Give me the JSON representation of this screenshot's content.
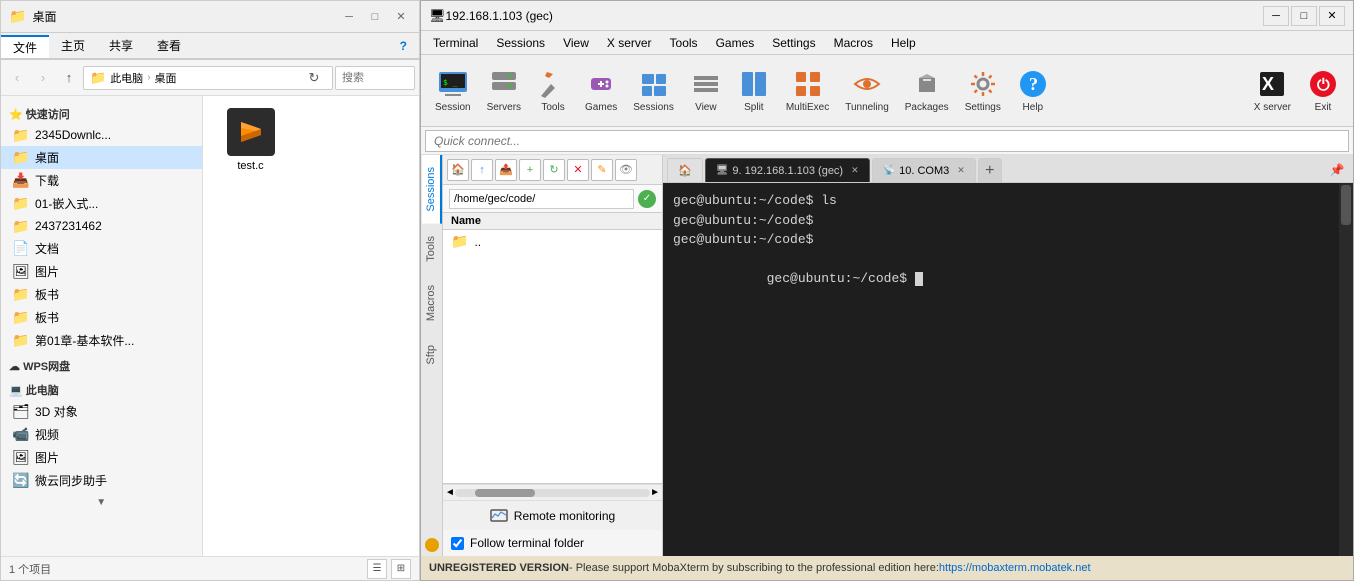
{
  "file_explorer": {
    "title": "桌面",
    "title_icon": "folder",
    "ribbon_tabs": [
      "文件",
      "主页",
      "共享",
      "查看"
    ],
    "active_tab": "主页",
    "address_bar": {
      "parts": [
        "此电脑",
        "桌面"
      ],
      "separator": "›"
    },
    "search_placeholder": "搜索",
    "nav_buttons": {
      "back": "‹",
      "forward": "›",
      "up": "↑",
      "history": "▾",
      "refresh": "↻"
    },
    "sidebar_sections": {
      "quick_access": {
        "label": "快速访问",
        "items": [
          {
            "label": "2345Downlc...",
            "icon": "folder",
            "pinned": true
          },
          {
            "label": "桌面",
            "icon": "folder",
            "active": true,
            "pinned": true
          },
          {
            "label": "下载",
            "icon": "folder-down",
            "pinned": true
          },
          {
            "label": "01-嵌入式...",
            "icon": "folder-yellow",
            "pinned": true
          },
          {
            "label": "2437231462",
            "icon": "folder-yellow",
            "pinned": true
          },
          {
            "label": "文档",
            "icon": "folder-doc",
            "pinned": true
          },
          {
            "label": "图片",
            "icon": "folder-pic",
            "pinned": true
          },
          {
            "label": "板书",
            "icon": "folder-yellow",
            "pinned": true
          },
          {
            "label": "板书",
            "icon": "folder-yellow",
            "pinned": true
          },
          {
            "label": "第01章-基本软件...",
            "icon": "folder-yellow",
            "pinned": true
          }
        ]
      },
      "wps": {
        "label": "WPS网盘",
        "icon": "cloud"
      },
      "this_pc": {
        "label": "此电脑",
        "items": [
          {
            "label": "3D 对象",
            "icon": "3d"
          },
          {
            "label": "视频",
            "icon": "video"
          },
          {
            "label": "图片",
            "icon": "picture"
          },
          {
            "label": "微云同步助手",
            "icon": "cloud-sync"
          }
        ]
      }
    },
    "files": [
      {
        "name": "test.c",
        "type": "sublime"
      }
    ],
    "statusbar": {
      "count_label": "1 个项目",
      "view_icons": [
        "list",
        "detail"
      ]
    }
  },
  "mobaxterm": {
    "title": "192.168.1.103 (gec)",
    "title_icon": "terminal",
    "menu_items": [
      "Terminal",
      "Sessions",
      "View",
      "X server",
      "Tools",
      "Games",
      "Settings",
      "Macros",
      "Help"
    ],
    "toolbar_items": [
      {
        "label": "Session",
        "icon": "session"
      },
      {
        "label": "Servers",
        "icon": "servers"
      },
      {
        "label": "Tools",
        "icon": "tools"
      },
      {
        "label": "Games",
        "icon": "games"
      },
      {
        "label": "Sessions",
        "icon": "sessions"
      },
      {
        "label": "View",
        "icon": "view"
      },
      {
        "label": "Split",
        "icon": "split"
      },
      {
        "label": "MultiExec",
        "icon": "multiexec"
      },
      {
        "label": "Tunneling",
        "icon": "tunneling"
      },
      {
        "label": "Packages",
        "icon": "packages"
      },
      {
        "label": "Settings",
        "icon": "settings"
      },
      {
        "label": "Help",
        "icon": "help"
      },
      {
        "label": "X server",
        "icon": "xserver"
      },
      {
        "label": "Exit",
        "icon": "exit"
      }
    ],
    "quick_connect_placeholder": "Quick connect...",
    "sidebar_tabs": [
      "Sessions",
      "Tools",
      "Macros",
      "Sftp"
    ],
    "sftp_panel": {
      "toolbar_buttons": [
        "home",
        "upload",
        "upload-folder",
        "new-folder",
        "refresh",
        "delete",
        "rename",
        "hidden"
      ],
      "path": "/home/gec/code/",
      "path_ok": "✓",
      "header": "Name",
      "items": [
        {
          "name": "..",
          "icon": "folder-up"
        }
      ],
      "scroll_buttons": [
        "◄",
        "►"
      ],
      "monitor_btn": "Remote monitoring",
      "follow_terminal_label": "Follow terminal folder",
      "follow_terminal_checked": true
    },
    "terminal": {
      "tabs": [
        {
          "label": "9. 192.168.1.103 (gec)",
          "active": true,
          "icon": "terminal"
        },
        {
          "label": "10. COM3",
          "active": false
        }
      ],
      "lines": [
        "gec@ubuntu:~/code$ ls",
        "gec@ubuntu:~/code$",
        "gec@ubuntu:~/code$",
        "gec@ubuntu:~/code$ "
      ],
      "cursor": true
    },
    "statusbar": {
      "unregistered_text": "UNREGISTERED VERSION",
      "support_text": " - Please support MobaXterm by subscribing to the professional edition here: ",
      "link_text": "https://mobaxterm.mobatek.net",
      "link_url": "https://mobaxterm.mobatek.net"
    }
  }
}
